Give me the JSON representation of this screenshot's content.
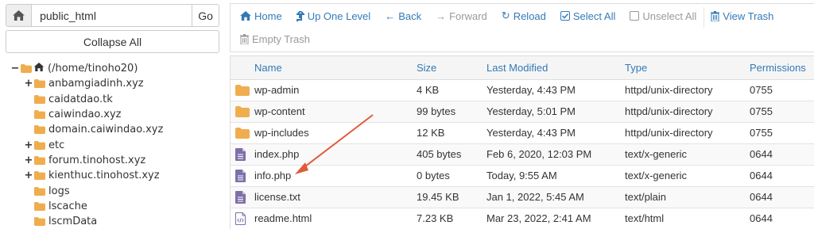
{
  "left": {
    "path_value": "public_html",
    "go_label": "Go",
    "collapse_label": "Collapse All",
    "tree": [
      {
        "label": "(/home/tinoho20)",
        "toggle": "−",
        "icon": "home-icon",
        "depth": 0
      },
      {
        "label": "anbamgiadinh.xyz",
        "toggle": "+",
        "icon": "folder-icon",
        "depth": 1
      },
      {
        "label": "caidatdao.tk",
        "toggle": "",
        "icon": "folder-icon",
        "depth": 1
      },
      {
        "label": "caiwindao.xyz",
        "toggle": "",
        "icon": "folder-icon",
        "depth": 1
      },
      {
        "label": "domain.caiwindao.xyz",
        "toggle": "",
        "icon": "folder-icon",
        "depth": 1
      },
      {
        "label": "etc",
        "toggle": "+",
        "icon": "folder-icon",
        "depth": 1
      },
      {
        "label": "forum.tinohost.xyz",
        "toggle": "+",
        "icon": "folder-icon",
        "depth": 1
      },
      {
        "label": "kienthuc.tinohost.xyz",
        "toggle": "+",
        "icon": "folder-icon",
        "depth": 1
      },
      {
        "label": "logs",
        "toggle": "",
        "icon": "folder-icon",
        "depth": 1
      },
      {
        "label": "lscache",
        "toggle": "",
        "icon": "folder-icon",
        "depth": 1
      },
      {
        "label": "lscmData",
        "toggle": "",
        "icon": "folder-icon",
        "depth": 1
      }
    ]
  },
  "toolbar": {
    "home": "Home",
    "up": "Up One Level",
    "back": "Back",
    "forward": "Forward",
    "reload": "Reload",
    "select_all": "Select All",
    "unselect_all": "Unselect All",
    "view_trash": "View Trash",
    "empty_trash": "Empty Trash"
  },
  "table": {
    "headers": {
      "name": "Name",
      "size": "Size",
      "modified": "Last Modified",
      "type": "Type",
      "permissions": "Permissions"
    },
    "rows": [
      {
        "icon": "folder-icon",
        "name": "wp-admin",
        "size": "4 KB",
        "modified": "Yesterday, 4:43 PM",
        "type": "httpd/unix-directory",
        "perm": "0755"
      },
      {
        "icon": "folder-icon",
        "name": "wp-content",
        "size": "99 bytes",
        "modified": "Yesterday, 5:01 PM",
        "type": "httpd/unix-directory",
        "perm": "0755"
      },
      {
        "icon": "folder-icon",
        "name": "wp-includes",
        "size": "12 KB",
        "modified": "Yesterday, 4:43 PM",
        "type": "httpd/unix-directory",
        "perm": "0755"
      },
      {
        "icon": "text-file-icon",
        "name": "index.php",
        "size": "405 bytes",
        "modified": "Feb 6, 2020, 12:03 PM",
        "type": "text/x-generic",
        "perm": "0644"
      },
      {
        "icon": "text-file-icon",
        "name": "info.php",
        "size": "0 bytes",
        "modified": "Today, 9:55 AM",
        "type": "text/x-generic",
        "perm": "0644"
      },
      {
        "icon": "text-file-icon",
        "name": "license.txt",
        "size": "19.45 KB",
        "modified": "Jan 1, 2022, 5:45 AM",
        "type": "text/plain",
        "perm": "0644"
      },
      {
        "icon": "html-file-icon",
        "name": "readme.html",
        "size": "7.23 KB",
        "modified": "Mar 23, 2022, 2:41 AM",
        "type": "text/html",
        "perm": "0644"
      }
    ]
  },
  "colors": {
    "link": "#337ab7",
    "folder": "#f0ad4e",
    "file": "#7e6fa8",
    "arrow": "#e05a3a"
  }
}
